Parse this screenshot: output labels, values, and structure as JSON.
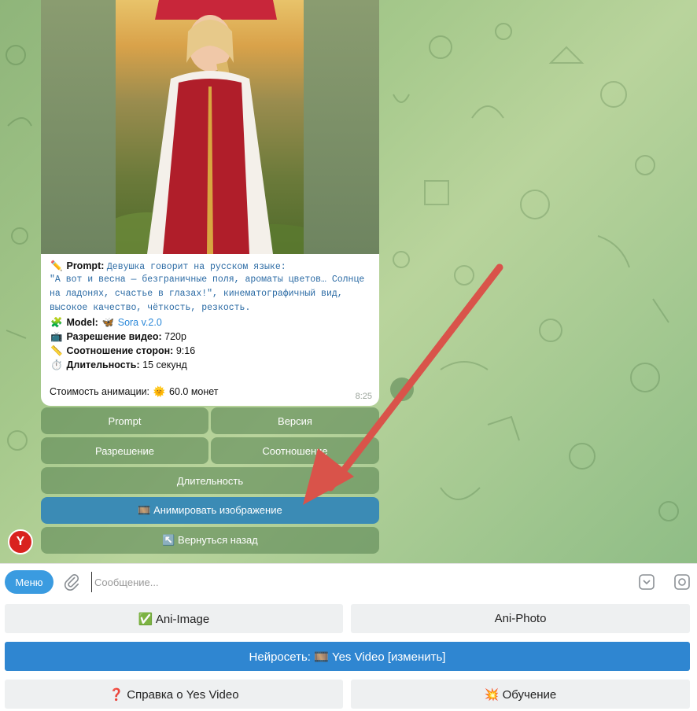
{
  "message": {
    "prompt_label": "Prompt:",
    "prompt_line1": "Девушка говорит на русском языке:",
    "prompt_line2": "\"А вот и весна — безграничные поля, ароматы цветов… Солнце",
    "prompt_line3": "на ладонях, счастье в глазах!\", кинематографичный вид,",
    "prompt_line4": "высокое качество, чёткость, резкость.",
    "model_label": "Model:",
    "model_value": "Sora v.2.0",
    "resolution_label": "Разрешение видео:",
    "resolution_value": "720p",
    "aspect_label": "Соотношение сторон:",
    "aspect_value": "9:16",
    "duration_label": "Длительность:",
    "duration_value": "15 секунд",
    "cost_label": "Стоимость анимации:",
    "cost_value": "60.0 монет",
    "time": "8:25",
    "icons": {
      "prompt": "pencil-icon",
      "model": "puzzle-icon",
      "model_value": "butterfly-icon",
      "resolution": "tv-icon",
      "aspect": "ruler-icon",
      "duration": "stopwatch-icon",
      "cost": "sun-icon"
    }
  },
  "inline_buttons": {
    "prompt": "Prompt",
    "version": "Версия",
    "resolution": "Разрешение",
    "aspect": "Соотношение",
    "duration": "Длительность",
    "animate": "🎞️ Анимировать изображение",
    "back": "↖️ Вернуться назад"
  },
  "input_bar": {
    "menu_label": "Меню",
    "placeholder": "Сообщение..."
  },
  "reply_keyboard": {
    "ani_image": "✅ Ani-Image",
    "ani_photo": "Ani-Photo",
    "neural": "Нейросеть: 🎞️ Yes Video [изменить]",
    "help": "❓ Справка о Yes Video",
    "learning": "💥 Обучение"
  },
  "colors": {
    "primary_button": "#3b8bb5",
    "menu_button": "#3a9be0",
    "neural_button": "#2f86d1",
    "arrow": "#d9534a",
    "avatar": "#d9221f"
  }
}
